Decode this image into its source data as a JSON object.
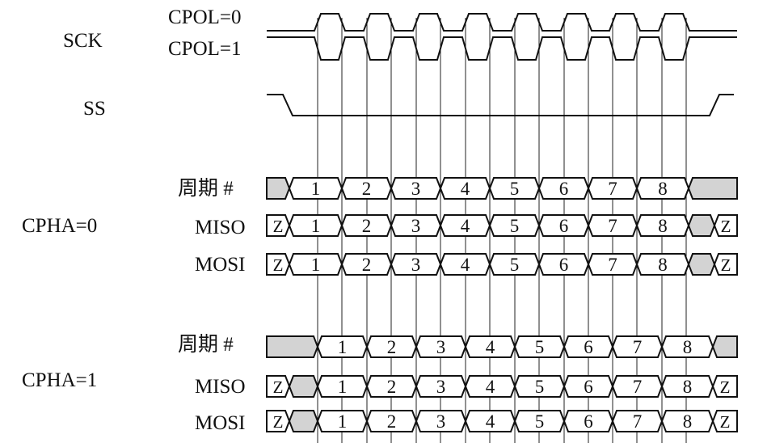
{
  "labels": {
    "sck": "SCK",
    "cpol0": "CPOL=0",
    "cpol1": "CPOL=1",
    "ss": "SS",
    "cpha0": "CPHA=0",
    "cpha1": "CPHA=1",
    "cycle": "周期 #",
    "miso": "MISO",
    "mosi": "MOSI",
    "highz": "Z"
  },
  "cycle_numbers": [
    "1",
    "2",
    "3",
    "4",
    "5",
    "6",
    "7",
    "8"
  ],
  "colors": {
    "line": "#111111",
    "grid": "#222222",
    "undefined_fill": "#d3d3d3",
    "background": "#ffffff"
  }
}
